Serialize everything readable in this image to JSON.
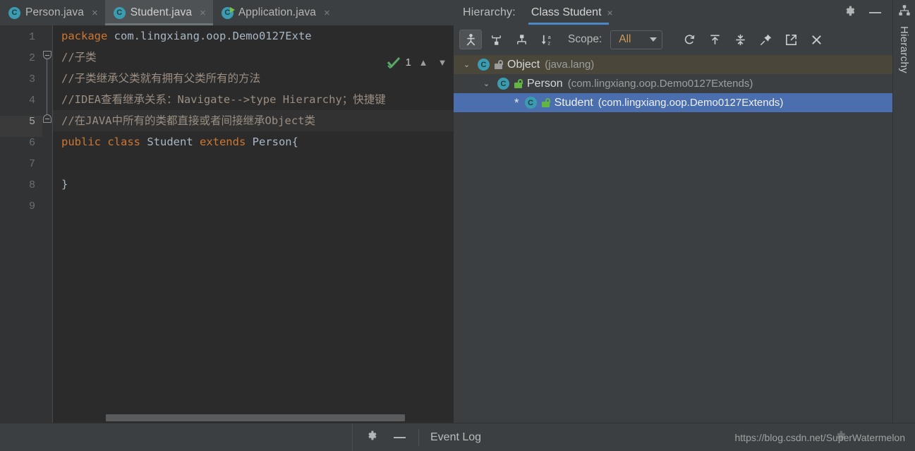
{
  "editor": {
    "tabs": [
      {
        "label": "Person.java",
        "icon": "java-class-icon",
        "active": false,
        "runnable": false
      },
      {
        "label": "Student.java",
        "icon": "java-class-icon",
        "active": true,
        "runnable": false
      },
      {
        "label": "Application.java",
        "icon": "java-class-runnable-icon",
        "active": false,
        "runnable": true
      }
    ],
    "close_glyph": "×",
    "gutter_lines": [
      "1",
      "2",
      "3",
      "4",
      "5",
      "6",
      "7",
      "8",
      "9"
    ],
    "current_line": 5,
    "lines": [
      {
        "n": 1,
        "tokens": [
          {
            "t": "package ",
            "c": "kw"
          },
          {
            "t": "com.lingxiang.oop.Demo0127Exte",
            "c": "pl"
          }
        ]
      },
      {
        "n": 2,
        "tokens": [
          {
            "t": "//子类",
            "c": "cm"
          }
        ]
      },
      {
        "n": 3,
        "tokens": [
          {
            "t": "//子类继承父类就有拥有父类所有的方法",
            "c": "cm"
          }
        ]
      },
      {
        "n": 4,
        "tokens": [
          {
            "t": "//IDEA查看继承关系：Navigate-->type Hierarchy；快捷键",
            "c": "cm"
          }
        ]
      },
      {
        "n": 5,
        "tokens": [
          {
            "t": "//在JAVA中所有的类都直接或者间接继承Object类",
            "c": "cm"
          }
        ]
      },
      {
        "n": 6,
        "tokens": [
          {
            "t": "public ",
            "c": "kw"
          },
          {
            "t": "class ",
            "c": "kw"
          },
          {
            "t": "Student ",
            "c": "cls"
          },
          {
            "t": "extends ",
            "c": "kw"
          },
          {
            "t": "Person{",
            "c": "cls"
          }
        ]
      },
      {
        "n": 7,
        "tokens": []
      },
      {
        "n": 8,
        "tokens": [
          {
            "t": "}",
            "c": "pl"
          }
        ]
      },
      {
        "n": 9,
        "tokens": []
      }
    ],
    "inspection": {
      "status_icon": "green-check-icon",
      "count": "1",
      "prev_icon": "chevron-up-icon",
      "next_icon": "chevron-down-icon"
    }
  },
  "hierarchy": {
    "title": "Hierarchy:",
    "tab_label": "Class Student",
    "tab_close_glyph": "×",
    "header_actions": [
      {
        "name": "settings-icon",
        "glyph": "gear"
      },
      {
        "name": "hide-icon",
        "glyph": "minus"
      }
    ],
    "toolbar": {
      "buttons": [
        {
          "name": "class-hierarchy-button",
          "selected": true
        },
        {
          "name": "subtypes-hierarchy-button",
          "selected": false
        },
        {
          "name": "supertypes-hierarchy-button",
          "selected": false
        },
        {
          "name": "sort-alphabetically-button",
          "selected": false
        }
      ],
      "scope_label": "Scope:",
      "scope_value": "All",
      "right_buttons": [
        {
          "name": "refresh-button"
        },
        {
          "name": "expand-all-button"
        },
        {
          "name": "collapse-all-button"
        },
        {
          "name": "pin-tab-button"
        },
        {
          "name": "export-button"
        },
        {
          "name": "close-button"
        }
      ]
    },
    "tree": [
      {
        "name": "Object",
        "package": "(java.lang)",
        "indent": 0,
        "twisty": "⌄",
        "state": "hover",
        "starred": false,
        "lock": "grey"
      },
      {
        "name": "Person",
        "package": "(com.lingxiang.oop.Demo0127Extends)",
        "indent": 1,
        "twisty": "⌄",
        "state": "normal",
        "starred": false,
        "lock": "green"
      },
      {
        "name": "Student",
        "package": "(com.lingxiang.oop.Demo0127Extends)",
        "indent": 2,
        "twisty": "",
        "state": "selected",
        "starred": true,
        "star_glyph": "*",
        "lock": "green"
      }
    ],
    "sidebar_label": "Hierarchy"
  },
  "statusbar": {
    "event_log": "Event Log",
    "watermark": "https://blog.csdn.net/SuperWatermelon"
  },
  "colors": {
    "editor_bg": "#2b2b2b",
    "panel_bg": "#3c3f41",
    "tab_active_bg": "#4e5254",
    "selection_blue": "#4b6eaf",
    "tab_underline": "#4a88c7",
    "keyword_orange": "#cc7832",
    "comment_grey": "#9b8e83",
    "plain_text": "#a9b7c6",
    "scope_value_color": "#cc9a52",
    "lock_green": "#62b543",
    "check_green": "#59a869",
    "class_icon_teal": "#3b9cb0",
    "run_arrow_green": "#7cbf42"
  }
}
